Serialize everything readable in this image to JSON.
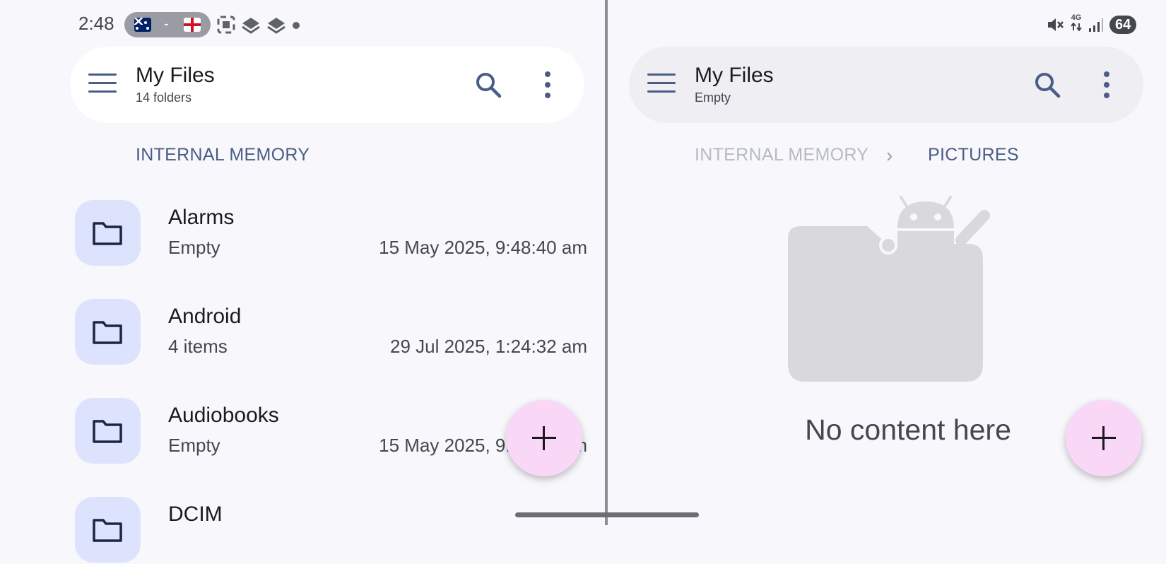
{
  "status_bar": {
    "time": "2:48",
    "media_separator": "-",
    "battery": "64",
    "network": "4G"
  },
  "left_pane": {
    "title": "My Files",
    "subtitle": "14 folders",
    "breadcrumb": "INTERNAL MEMORY",
    "items": [
      {
        "name": "Alarms",
        "meta": "Empty",
        "date": "15 May 2025, 9:48:40 am"
      },
      {
        "name": "Android",
        "meta": "4 items",
        "date": "29 Jul 2025, 1:24:32 am"
      },
      {
        "name": "Audiobooks",
        "meta": "Empty",
        "date": "15 May 2025, 9:48:40 am"
      },
      {
        "name": "DCIM",
        "meta": "",
        "date": ""
      }
    ]
  },
  "right_pane": {
    "title": "My Files",
    "subtitle": "Empty",
    "breadcrumb_root": "INTERNAL MEMORY",
    "breadcrumb_current": "PICTURES",
    "empty_message": "No content here"
  },
  "icons": {
    "menu": "hamburger-menu-icon",
    "search": "search-icon",
    "more": "more-vert-icon",
    "folder": "folder-icon",
    "add": "plus-icon"
  },
  "colors": {
    "accent": "#4a5d85",
    "folder_tile": "#dde3fd",
    "fab": "#f8d7f7",
    "background": "#f8f8fc"
  }
}
